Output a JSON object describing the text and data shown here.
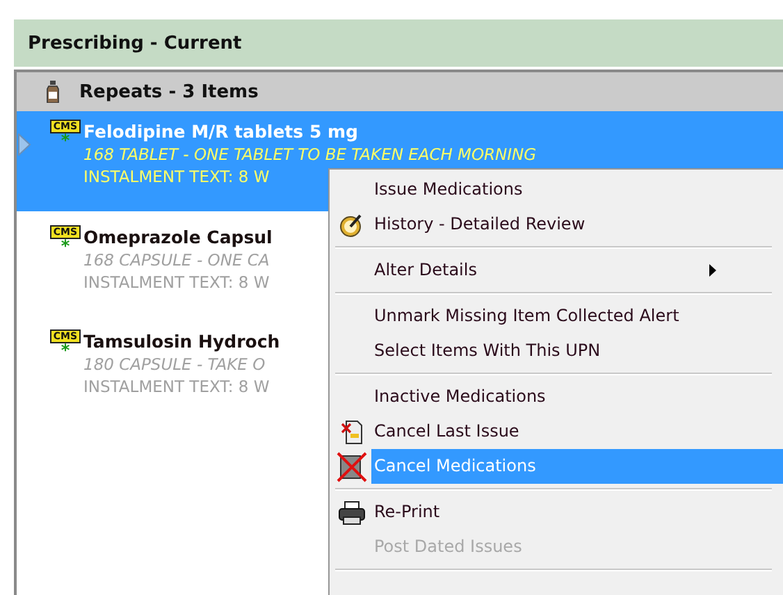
{
  "header": {
    "title": "Prescribing - Current"
  },
  "group": {
    "title": "Repeats - 3 Items"
  },
  "items": [
    {
      "badge": "CMS",
      "marker": "*",
      "name": "Felodipine  M/R tablets  5 mg",
      "dosage": "168 TABLET - ONE TABLET TO BE TAKEN EACH MORNING",
      "instalment": "INSTALMENT TEXT: 8 W",
      "selected": true
    },
    {
      "badge": "CMS",
      "marker": "*",
      "name": "Omeprazole  Capsul",
      "dosage": "168 CAPSULE - ONE CA",
      "instalment": "INSTALMENT TEXT: 8 W",
      "selected": false
    },
    {
      "badge": "CMS",
      "marker": "*",
      "name": "Tamsulosin Hydroch",
      "dosage": "180 CAPSULE - TAKE O",
      "instalment": "INSTALMENT TEXT: 8 W",
      "selected": false
    }
  ],
  "context_menu": {
    "sections": [
      [
        {
          "label": "Issue Medications",
          "kind": "plain",
          "submenu": false,
          "disabled": false,
          "selected": false
        },
        {
          "label": "History - Detailed Review",
          "kind": "clock",
          "submenu": false,
          "disabled": false,
          "selected": false
        }
      ],
      [
        {
          "label": "Alter Details",
          "kind": "plain",
          "submenu": true,
          "disabled": false,
          "selected": false
        }
      ],
      [
        {
          "label": "Unmark Missing Item Collected Alert",
          "kind": "plain",
          "submenu": false,
          "disabled": false,
          "selected": false
        },
        {
          "label": "Select Items With This UPN",
          "kind": "plain",
          "submenu": false,
          "disabled": false,
          "selected": false
        }
      ],
      [
        {
          "label": "Inactive Medications",
          "kind": "plain",
          "submenu": false,
          "disabled": false,
          "selected": false
        },
        {
          "label": "Cancel Last Issue",
          "kind": "canceldoc",
          "submenu": false,
          "disabled": false,
          "selected": false
        },
        {
          "label": "Cancel Medications",
          "kind": "cross",
          "submenu": false,
          "disabled": false,
          "selected": true
        }
      ],
      [
        {
          "label": "Re-Print",
          "kind": "printer",
          "submenu": false,
          "disabled": false,
          "selected": false
        },
        {
          "label": "Post Dated Issues",
          "kind": "plain",
          "submenu": false,
          "disabled": true,
          "selected": false
        }
      ]
    ]
  }
}
